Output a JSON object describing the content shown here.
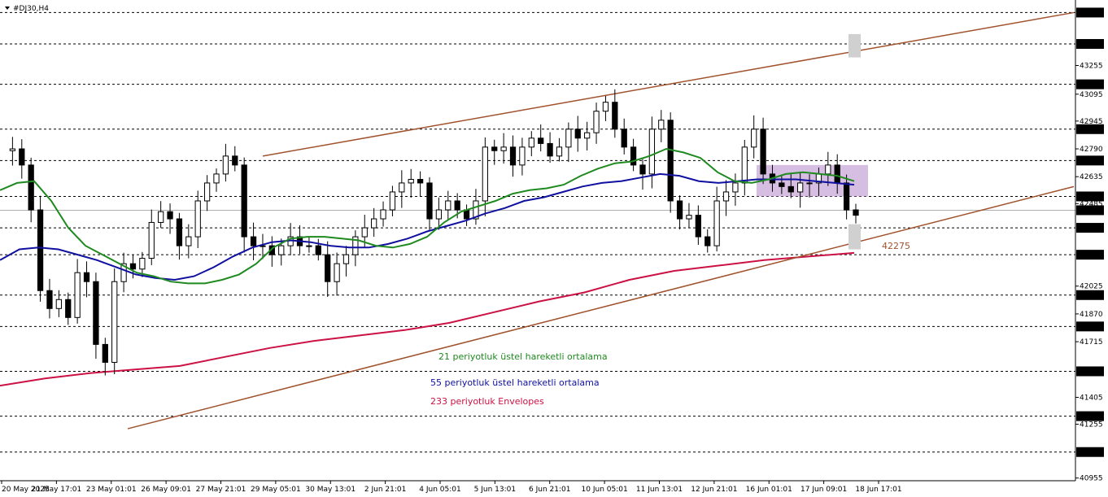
{
  "symbol_label": "#DJ30,H4",
  "colors": {
    "ema21": "#1f8a1f",
    "ema55": "#1010a0",
    "env233": "#cc1144",
    "channel": "#a0522d",
    "zone": "#c8a8d8",
    "grey_box": "#d0d0d0",
    "bull": "#ffffff",
    "bear": "#000000"
  },
  "chart_data": {
    "type": "candlestick",
    "ylim": [
      40940,
      43620
    ],
    "price_levels": [
      43550,
      43375,
      43150,
      42900,
      42725,
      42525,
      42448,
      42350,
      42200,
      41975,
      41800,
      41550,
      41300,
      41100
    ],
    "current_price": "42448",
    "axis_ticks": [
      "43255",
      "43095",
      "42945",
      "42790",
      "42635",
      "42485",
      "42025",
      "41870",
      "41715",
      "41405",
      "41255",
      "40955"
    ],
    "time_labels": [
      "20 May 2025",
      "21 May 17:01",
      "23 May 01:01",
      "26 May 09:01",
      "27 May 21:01",
      "29 May 05:01",
      "30 May 13:01",
      "2 Jun 21:01",
      "4 Jun 05:01",
      "5 Jun 13:01",
      "6 Jun 21:01",
      "10 Jun 05:01",
      "11 Jun 13:01",
      "12 Jun 21:01",
      "16 Jun 01:01",
      "17 Jun 09:01",
      "18 Jun 17:01"
    ],
    "close_path": [
      42780,
      42790,
      42700,
      42450,
      42000,
      41900,
      41950,
      41850,
      42100,
      42050,
      41700,
      41600,
      42050,
      42150,
      42120,
      42180,
      42380,
      42440,
      42400,
      42250,
      42300,
      42500,
      42600,
      42650,
      42750,
      42700,
      42300,
      42250,
      42250,
      42200,
      42250,
      42300,
      42250,
      42250,
      42200,
      42050,
      42150,
      42200,
      42300,
      42350,
      42400,
      42450,
      42550,
      42600,
      42620,
      42600,
      42400,
      42450,
      42500,
      42450,
      42400,
      42500,
      42800,
      42780,
      42800,
      42700,
      42800,
      42850,
      42820,
      42750,
      42800,
      42900,
      42850,
      42880,
      43000,
      43050,
      42900,
      42800,
      42700,
      42650,
      42900,
      42950,
      42500,
      42400,
      42420,
      42300,
      42250,
      42500,
      42550,
      42600,
      42800,
      42900,
      42650,
      42600,
      42580,
      42550,
      42600,
      42600,
      42650,
      42700,
      42600,
      42450,
      42420
    ],
    "ema21": [
      42560,
      42600,
      42610,
      42500,
      42350,
      42250,
      42200,
      42150,
      42100,
      42080,
      42050,
      42040,
      42040,
      42060,
      42090,
      42150,
      42240,
      42290,
      42300,
      42300,
      42290,
      42280,
      42250,
      42240,
      42260,
      42300,
      42380,
      42440,
      42470,
      42500,
      42540,
      42560,
      42570,
      42590,
      42640,
      42680,
      42710,
      42720,
      42750,
      42790,
      42770,
      42740,
      42660,
      42610,
      42600,
      42620,
      42650,
      42660,
      42650,
      42640,
      42610
    ],
    "ema55": [
      42170,
      42230,
      42240,
      42230,
      42200,
      42170,
      42130,
      42090,
      42070,
      42060,
      42080,
      42130,
      42190,
      42240,
      42270,
      42280,
      42270,
      42250,
      42240,
      42240,
      42260,
      42290,
      42330,
      42360,
      42390,
      42430,
      42460,
      42500,
      42520,
      42550,
      42580,
      42600,
      42610,
      42630,
      42650,
      42640,
      42610,
      42600,
      42610,
      42620,
      42620,
      42620,
      42610,
      42600,
      42590
    ],
    "env233": [
      41470,
      41510,
      41540,
      41560,
      41580,
      41630,
      41680,
      41720,
      41750,
      41780,
      41820,
      41880,
      41940,
      41990,
      42060,
      42110,
      42140,
      42170,
      42190,
      42210
    ],
    "channel_upper": {
      "from": [
        323,
        42750
      ],
      "to": [
        1320,
        43550
      ]
    },
    "channel_lower": {
      "from": [
        157,
        41230
      ],
      "to": [
        1320,
        42580
      ]
    },
    "zone_box": {
      "x1": 930,
      "x2": 1067,
      "y_top": 42700,
      "y_bottom": 42525
    },
    "target_label": "42275",
    "legend": [
      {
        "name": "21 periyotluk üstel hareketli ortalama",
        "color": "#1f8a1f"
      },
      {
        "name": "55 periyotluk üstel hareketli ortalama",
        "color": "#1010a0"
      },
      {
        "name": "233 periyotluk Envelopes",
        "color": "#cc1144"
      }
    ]
  }
}
